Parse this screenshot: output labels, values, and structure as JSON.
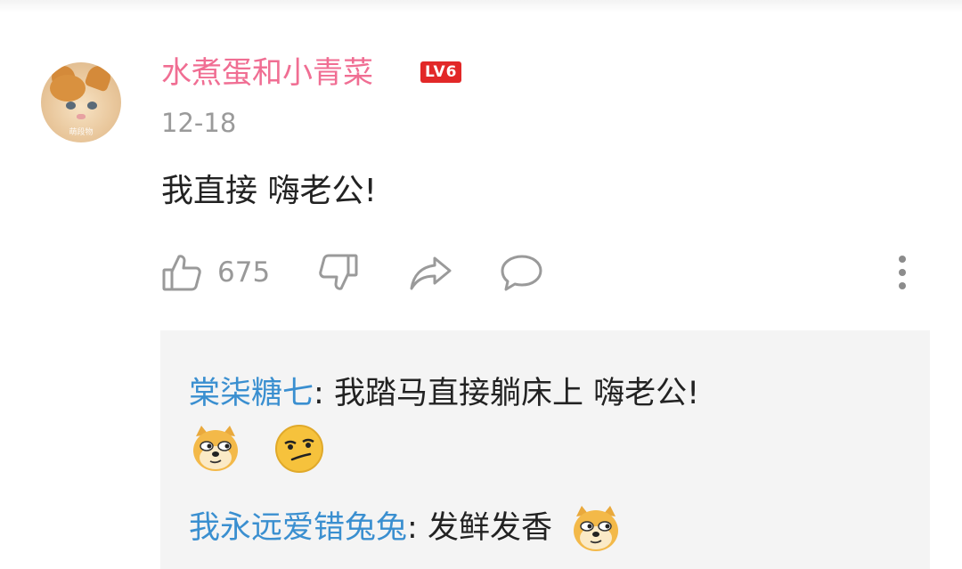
{
  "comment": {
    "username": "水煮蛋和小青菜",
    "level": "LV6",
    "date": "12-18",
    "text": "我直接 嗨老公!",
    "avatar_watermark": "萌段物",
    "like_count": "675"
  },
  "replies": [
    {
      "user": "棠柒糖七",
      "separator": ": ",
      "text": "我踏马直接躺床上 嗨老公!",
      "emojis": [
        "doge-emoji",
        "smirk-emoji"
      ]
    },
    {
      "user": "我永远爱错兔兔",
      "separator": ": ",
      "text": "发鲜发香",
      "emojis": [
        "doge-emoji"
      ]
    }
  ],
  "icons": {
    "like": "thumbs-up-icon",
    "dislike": "thumbs-down-icon",
    "share": "share-icon",
    "reply": "comment-icon",
    "more": "more-vertical-icon"
  },
  "colors": {
    "username": "#f06e93",
    "reply_user": "#3a8fd0",
    "level_badge": "#e22828",
    "muted": "#9a9a9a"
  }
}
